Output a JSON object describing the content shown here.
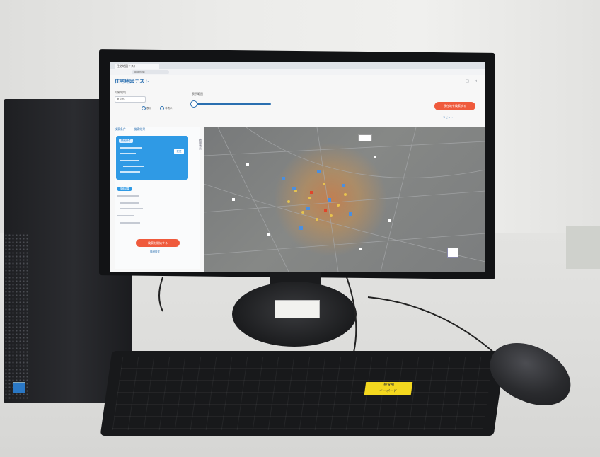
{
  "browser": {
    "tab_title": "住宅地図テスト",
    "url": "localhost"
  },
  "app": {
    "title": "住宅地図テスト",
    "window_controls": "– □ ×"
  },
  "controls": {
    "area_label": "対象地域",
    "area_value": "東京都",
    "slider_label": "表示範囲",
    "radio_options": [
      "表示",
      "非表示"
    ],
    "primary_button": "現在地を検索する",
    "secondary_link": "リセット"
  },
  "sidebar": {
    "tabs": [
      "検索条件",
      "検索結果"
    ],
    "card_title": "検索条件",
    "card_button": "変更",
    "second_section_title": "検索結果",
    "bottom_button": "検索を開始する",
    "bottom_link": "詳細設定"
  },
  "map": {
    "vertical_label": "地図表示"
  },
  "keyboard": {
    "sticker_line1": "検査用",
    "sticker_line2": "キーボード"
  }
}
